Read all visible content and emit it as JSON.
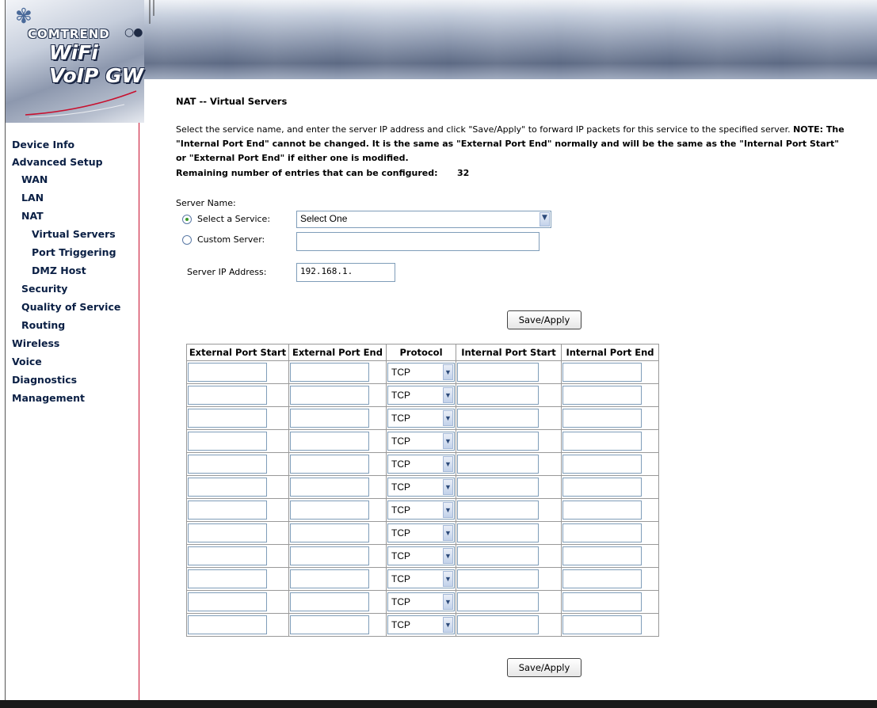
{
  "header": {
    "brand": "COMTREND",
    "product": "WiFi VoIP GW"
  },
  "sidebar": {
    "items": [
      {
        "label": "Device Info",
        "level": 0
      },
      {
        "label": "Advanced Setup",
        "level": 0
      },
      {
        "label": "WAN",
        "level": 1
      },
      {
        "label": "LAN",
        "level": 1
      },
      {
        "label": "NAT",
        "level": 1
      },
      {
        "label": "Virtual Servers",
        "level": 2
      },
      {
        "label": "Port Triggering",
        "level": 2
      },
      {
        "label": "DMZ Host",
        "level": 2
      },
      {
        "label": "Security",
        "level": 1
      },
      {
        "label": "Quality of Service",
        "level": 1
      },
      {
        "label": "Routing",
        "level": 1
      },
      {
        "label": "Wireless",
        "level": 0
      },
      {
        "label": "Voice",
        "level": 0
      },
      {
        "label": "Diagnostics",
        "level": 0
      },
      {
        "label": "Management",
        "level": 0
      }
    ]
  },
  "main": {
    "title": "NAT -- Virtual Servers",
    "desc1_a": "Select the service name, and enter the server IP address and click \"Save/Apply\" to forward IP packets for this service to the specified server.",
    "desc1_b": "NOTE: The",
    "desc2": "\"Internal Port End\" cannot be changed. It is the same as \"External Port End\" normally and will be the same as the \"Internal Port Start\"",
    "desc3": "or \"External Port End\" if either one is modified.",
    "remaining_label": "Remaining number of entries that can be configured:",
    "remaining_count": "32",
    "server_name_label": "Server Name:",
    "select_service_label": "Select a Service:",
    "select_service_value": "Select One",
    "custom_server_label": "Custom Server:",
    "custom_server_value": "",
    "server_ip_label": "Server IP Address:",
    "server_ip_value": "192.168.1.",
    "save_label": "Save/Apply"
  },
  "table": {
    "headers": [
      "External Port Start",
      "External Port End",
      "Protocol",
      "Internal Port Start",
      "Internal Port End"
    ],
    "rows": [
      {
        "protocol": "TCP"
      },
      {
        "protocol": "TCP"
      },
      {
        "protocol": "TCP"
      },
      {
        "protocol": "TCP"
      },
      {
        "protocol": "TCP"
      },
      {
        "protocol": "TCP"
      },
      {
        "protocol": "TCP"
      },
      {
        "protocol": "TCP"
      },
      {
        "protocol": "TCP"
      },
      {
        "protocol": "TCP"
      },
      {
        "protocol": "TCP"
      },
      {
        "protocol": "TCP"
      }
    ]
  },
  "colors": {
    "nav_text": "#0a1f44",
    "divider": "#c8102e",
    "radio_selected": "#3a9a2a"
  }
}
